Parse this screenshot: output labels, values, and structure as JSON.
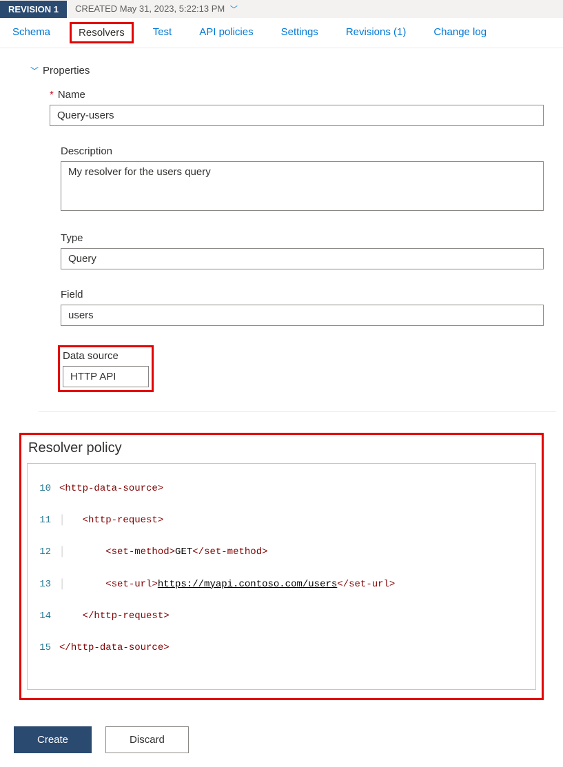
{
  "revision": {
    "badge": "REVISION 1",
    "created_prefix": "CREATED",
    "created_date": "May 31, 2023, 5:22:13 PM"
  },
  "tabs": {
    "schema": "Schema",
    "resolvers": "Resolvers",
    "test": "Test",
    "api_policies": "API policies",
    "settings": "Settings",
    "revisions": "Revisions (1)",
    "change_log": "Change log"
  },
  "section": {
    "title": "Properties"
  },
  "form": {
    "name_label": "Name",
    "name_value": "Query-users",
    "description_label": "Description",
    "description_value": "My resolver for the users query",
    "type_label": "Type",
    "type_value": "Query",
    "field_label": "Field",
    "field_value": "users",
    "datasource_label": "Data source",
    "datasource_value": "HTTP API"
  },
  "resolver": {
    "title": "Resolver policy",
    "line_numbers": [
      "10",
      "11",
      "12",
      "13",
      "14",
      "15"
    ],
    "tags": {
      "http_data_source": "http-data-source",
      "http_request": "http-request",
      "set_method": "set-method",
      "set_url": "set-url"
    },
    "method_value": "GET",
    "url_value": "https://myapi.contoso.com/users"
  },
  "buttons": {
    "create": "Create",
    "discard": "Discard"
  }
}
